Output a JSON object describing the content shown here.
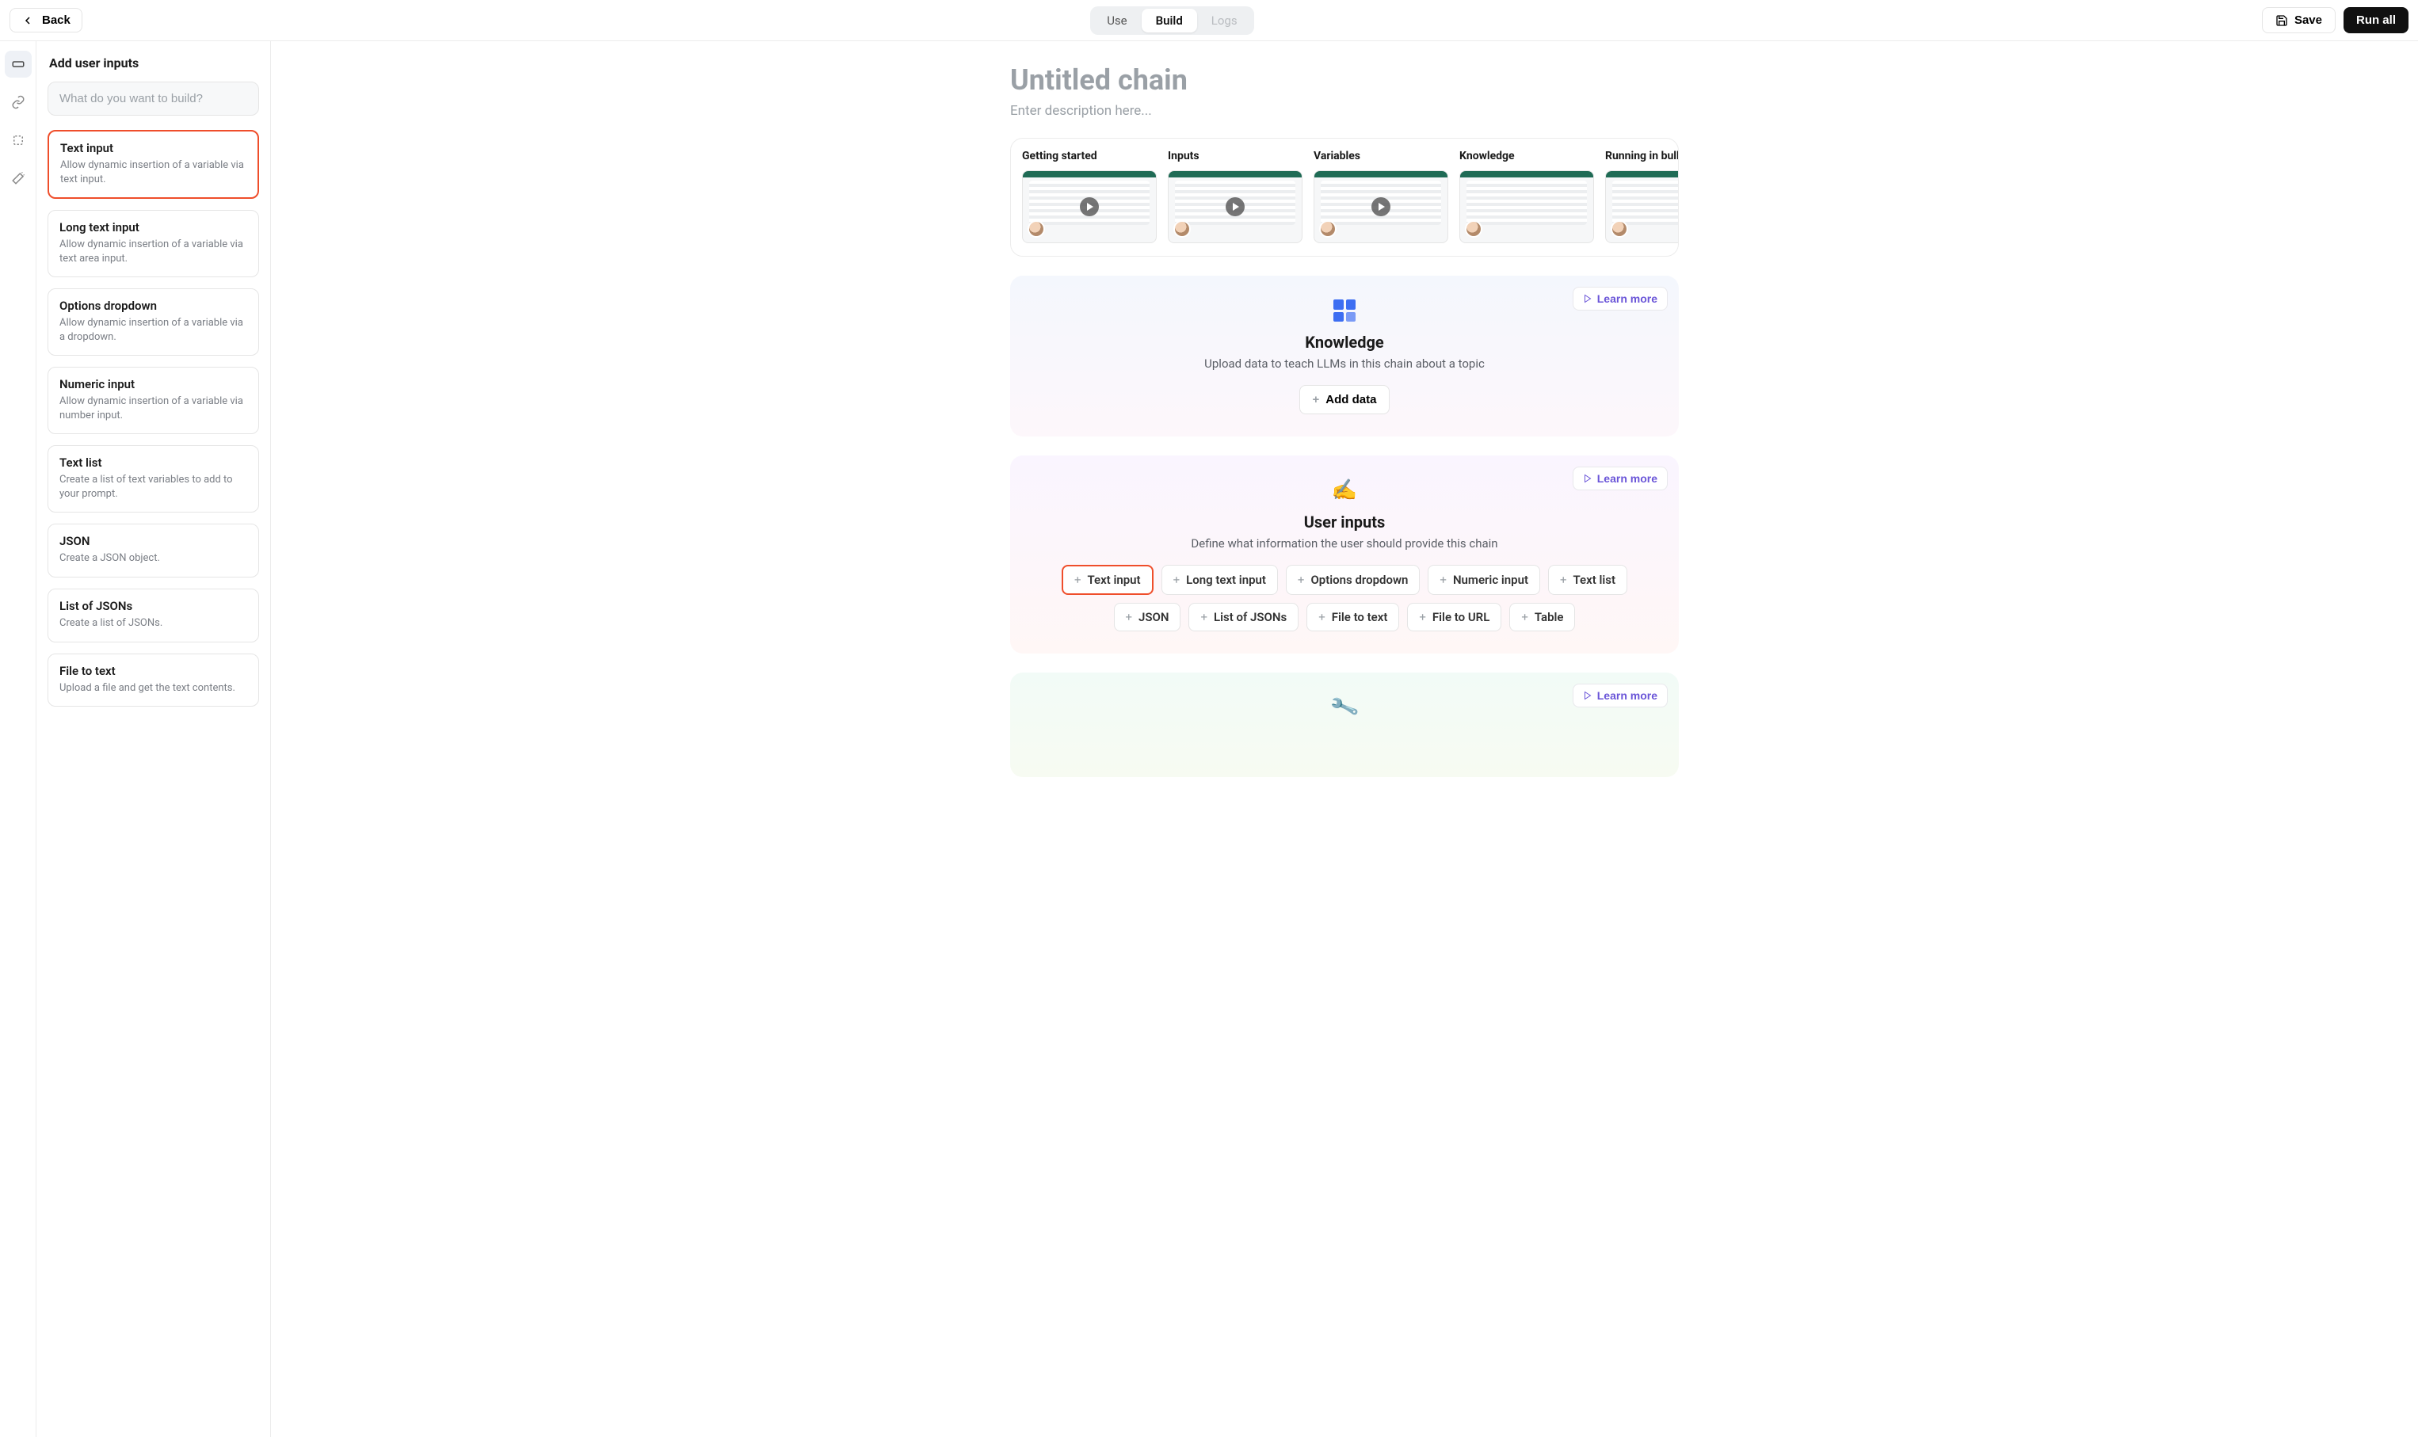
{
  "header": {
    "back": "Back",
    "tabs": {
      "use": "Use",
      "build": "Build",
      "logs": "Logs"
    },
    "save": "Save",
    "run_all": "Run all"
  },
  "sidebar": {
    "title": "Add user inputs",
    "search_placeholder": "What do you want to build?",
    "items": [
      {
        "title": "Text input",
        "desc": "Allow dynamic insertion of a variable via text input.",
        "selected": true
      },
      {
        "title": "Long text input",
        "desc": "Allow dynamic insertion of a variable via text area input."
      },
      {
        "title": "Options dropdown",
        "desc": "Allow dynamic insertion of a variable via a dropdown."
      },
      {
        "title": "Numeric input",
        "desc": "Allow dynamic insertion of a variable via number input."
      },
      {
        "title": "Text list",
        "desc": "Create a list of text variables to add to your prompt."
      },
      {
        "title": "JSON",
        "desc": "Create a JSON object."
      },
      {
        "title": "List of JSONs",
        "desc": "Create a list of JSONs."
      },
      {
        "title": "File to text",
        "desc": "Upload a file and get the text contents."
      }
    ]
  },
  "main": {
    "title": "Untitled chain",
    "desc_placeholder": "Enter description here...",
    "tutorials": [
      {
        "title": "Getting started"
      },
      {
        "title": "Inputs"
      },
      {
        "title": "Variables"
      },
      {
        "title": "Knowledge"
      },
      {
        "title": "Running in bulk"
      }
    ],
    "knowledge": {
      "title": "Knowledge",
      "sub": "Upload data to teach LLMs in this chain about a topic",
      "add": "Add data",
      "learn": "Learn more"
    },
    "user_inputs": {
      "title": "User inputs",
      "sub": "Define what information the user should provide this chain",
      "learn": "Learn more",
      "chips": [
        {
          "label": "Text input",
          "selected": true
        },
        {
          "label": "Long text input"
        },
        {
          "label": "Options dropdown"
        },
        {
          "label": "Numeric input"
        },
        {
          "label": "Text list"
        },
        {
          "label": "JSON"
        },
        {
          "label": "List of JSONs"
        },
        {
          "label": "File to text"
        },
        {
          "label": "File to URL"
        },
        {
          "label": "Table"
        }
      ]
    },
    "tools": {
      "learn": "Learn more"
    }
  }
}
